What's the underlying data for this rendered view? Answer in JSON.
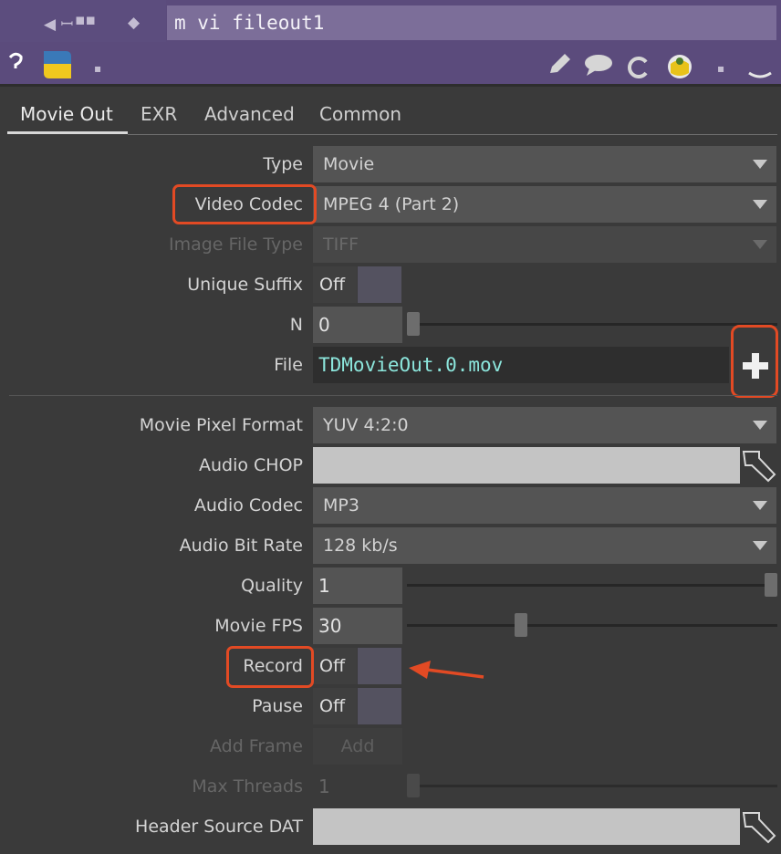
{
  "header": {
    "node_name": "m vi fileout1",
    "icons": [
      "help-icon",
      "python-icon",
      "pencil-icon",
      "comment-icon",
      "refresh-icon",
      "info-icon"
    ]
  },
  "tabs": [
    {
      "label": "Movie Out",
      "active": true
    },
    {
      "label": "EXR",
      "active": false
    },
    {
      "label": "Advanced",
      "active": false
    },
    {
      "label": "Common",
      "active": false
    }
  ],
  "params": {
    "type": {
      "label": "Type",
      "value": "Movie"
    },
    "video_codec": {
      "label": "Video Codec",
      "value": "MPEG 4 (Part 2)"
    },
    "image_file_type": {
      "label": "Image File Type",
      "value": "TIFF"
    },
    "unique_suffix": {
      "label": "Unique Suffix",
      "value": "Off"
    },
    "n": {
      "label": "N",
      "value": "0",
      "slider_fraction": 0.0
    },
    "file": {
      "label": "File",
      "value": "TDMovieOut.0.mov"
    },
    "movie_pixel_format": {
      "label": "Movie Pixel Format",
      "value": "YUV 4:2:0"
    },
    "audio_chop": {
      "label": "Audio CHOP",
      "value": ""
    },
    "audio_codec": {
      "label": "Audio Codec",
      "value": "MP3"
    },
    "audio_bit_rate": {
      "label": "Audio Bit Rate",
      "value": "128 kb/s"
    },
    "quality": {
      "label": "Quality",
      "value": "1",
      "slider_fraction": 1.0
    },
    "movie_fps": {
      "label": "Movie FPS",
      "value": "30",
      "slider_fraction": 0.3
    },
    "record": {
      "label": "Record",
      "value": "Off"
    },
    "pause": {
      "label": "Pause",
      "value": "Off"
    },
    "add_frame": {
      "label": "Add Frame",
      "button": "Add"
    },
    "max_threads": {
      "label": "Max Threads",
      "value": "1",
      "slider_fraction": 0.0
    },
    "header_source_dat": {
      "label": "Header Source DAT",
      "value": ""
    }
  },
  "colors": {
    "header_bg": "#5b4b7c",
    "panel_bg": "#3a3a3a",
    "annotation": "#e24a24",
    "file_text": "#8ce6dc"
  }
}
